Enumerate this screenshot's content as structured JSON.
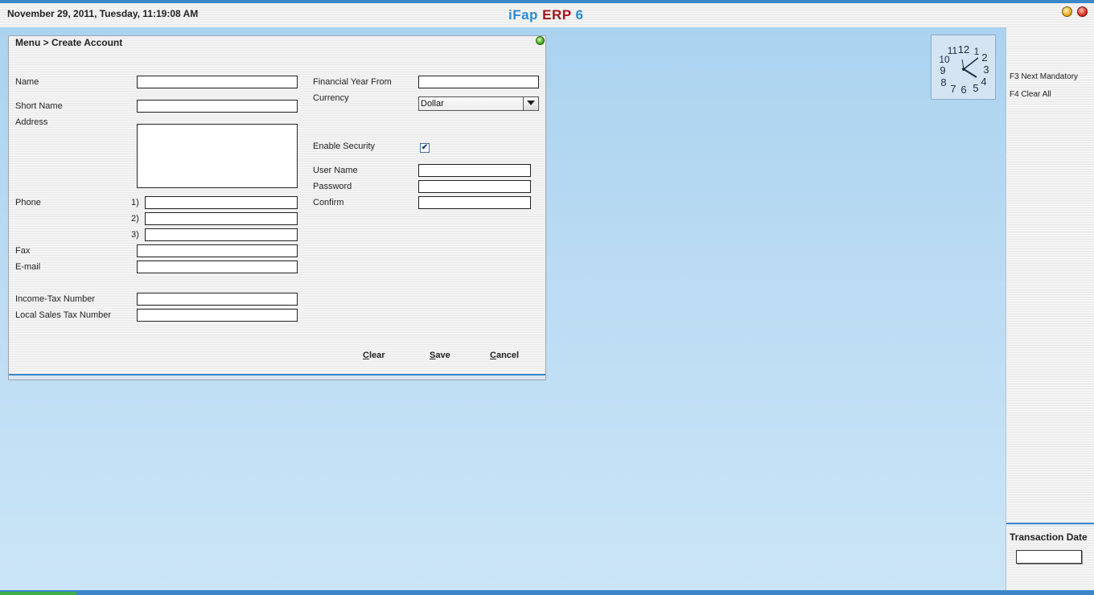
{
  "header": {
    "datetime": "November  29, 2011, Tuesday, 11:19:08 AM",
    "title_part1": "iFap ",
    "title_part2": "ERP",
    "title_part3": " 6"
  },
  "form": {
    "breadcrumb": "Menu > Create Account",
    "labels": {
      "name": "Name",
      "short_name": "Short Name",
      "address": "Address",
      "phone": "Phone",
      "phone1": "1)",
      "phone2": "2)",
      "phone3": "3)",
      "fax": "Fax",
      "email": "E-mail",
      "income_tax": "Income-Tax Number",
      "local_sales_tax": "Local Sales Tax Number",
      "financial_year_from": "Financial Year From",
      "currency": "Currency",
      "enable_security": "Enable Security",
      "user_name": "User Name",
      "password": "Password",
      "confirm": "Confirm"
    },
    "values": {
      "name": "",
      "short_name": "",
      "address": "",
      "phone1": "",
      "phone2": "",
      "phone3": "",
      "fax": "",
      "email": "",
      "income_tax": "",
      "local_sales_tax": "",
      "financial_year_from": "",
      "currency": "Dollar",
      "enable_security": "✔",
      "user_name": "",
      "password": "",
      "confirm": ""
    },
    "buttons": {
      "clear_first": "C",
      "clear_rest": "lear",
      "save_first": "S",
      "save_rest": "ave",
      "cancel_first": "C",
      "cancel_rest": "ancel"
    }
  },
  "shortcuts": {
    "f3": "F3 Next Mandatory",
    "f4": "F4 Clear All"
  },
  "transaction": {
    "label": "Transaction Date",
    "value": ""
  },
  "icons": {
    "minimize": "minimize-icon",
    "close": "close-icon",
    "status": "status-dot-icon",
    "dropdown": "chevron-down-icon",
    "clock": "clock-icon"
  },
  "colors": {
    "accent_blue": "#3b86c8",
    "title_blue": "#2a8ad6",
    "title_red": "#a2141e"
  }
}
